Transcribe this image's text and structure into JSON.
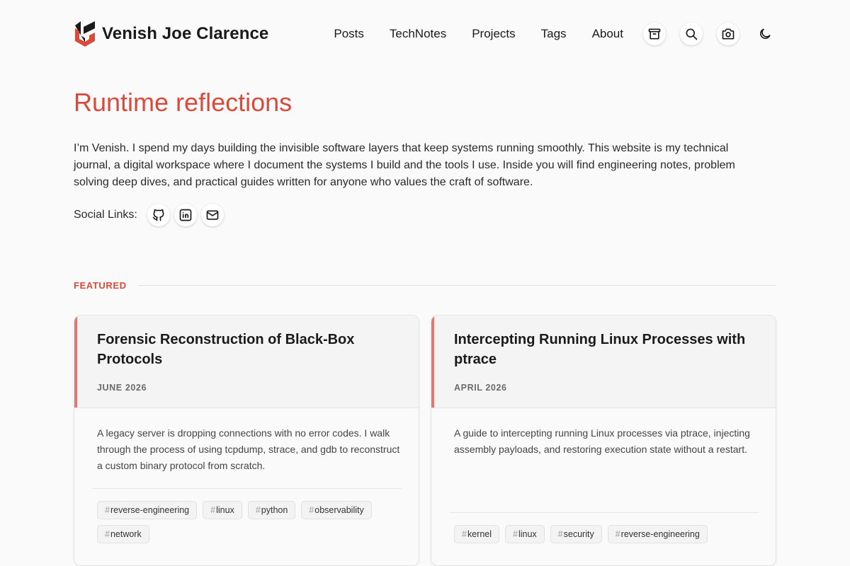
{
  "brand": {
    "name": "Venish Joe Clarence",
    "logo_icon": "vjc-logo-icon",
    "logo_colors": {
      "dark": "#1a1a1a",
      "accent": "#d94a3b"
    }
  },
  "nav": {
    "links": [
      {
        "label": "Posts"
      },
      {
        "label": "TechNotes"
      },
      {
        "label": "Projects"
      },
      {
        "label": "Tags"
      },
      {
        "label": "About"
      }
    ],
    "icons": [
      "archive-icon",
      "search-icon",
      "camera-icon",
      "moon-icon"
    ]
  },
  "hero": {
    "title": "Runtime reflections",
    "intro": "I’m Venish. I spend my days building the invisible software layers that keep systems running smoothly. This website is my technical journal, a digital workspace where I document the systems I build and the tools I use. Inside you will find engineering notes, problem solving deep dives, and practical guides written for anyone who values the craft of software.",
    "social_label": "Social Links:",
    "social_icons": [
      "github-icon",
      "linkedin-icon",
      "mail-icon"
    ]
  },
  "featured": {
    "label": "FEATURED",
    "cards": [
      {
        "title": "Forensic Reconstruction of Black-Box Protocols",
        "date": "JUNE 2026",
        "description": "A legacy server is dropping connections with no error codes. I walk through the process of using tcpdump, strace, and gdb to reconstruct a custom binary protocol from scratch.",
        "tags": [
          "reverse-engineering",
          "linux",
          "python",
          "observability",
          "network"
        ]
      },
      {
        "title": "Intercepting Running Linux Processes with ptrace",
        "date": "APRIL 2026",
        "description": "A guide to intercepting running Linux processes via ptrace, injecting assembly payloads, and restoring execution state without a restart.",
        "tags": [
          "kernel",
          "linux",
          "security",
          "reverse-engineering"
        ]
      }
    ]
  },
  "colors": {
    "accent": "#d94a3b",
    "card_stripe": "#e07a70",
    "background": "#fafafa"
  }
}
